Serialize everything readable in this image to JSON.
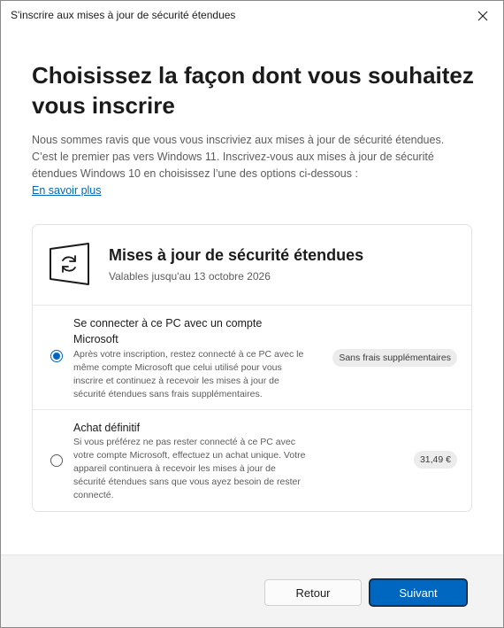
{
  "window": {
    "title": "S'inscrire aux mises à jour de sécurité étendues"
  },
  "heading": "Choisissez la façon dont vous souhaitez vous inscrire",
  "intro": "Nous sommes ravis que vous vous inscriviez aux mises à jour de sécurité étendues. C’est le premier pas vers Windows 11. Inscrivez-vous aux mises à jour de sécurité étendues Windows 10 en choisissez l’une des options ci-dessous :",
  "learn_more": "En savoir plus",
  "card": {
    "icon": "windows-refresh-icon",
    "title": "Mises à jour de sécurité étendues",
    "subtitle": "Valables jusqu'au 13 octobre 2026"
  },
  "options": [
    {
      "title": "Se connecter à ce PC avec un compte Microsoft",
      "description": "Après votre inscription, restez connecté à ce PC avec le même compte Microsoft que celui utilisé pour vous inscrire et continuez à recevoir les mises à jour de sécurité étendues sans frais supplémentaires.",
      "badge": "Sans frais supplémentaires",
      "selected": true
    },
    {
      "title": "Achat définitif",
      "description": "Si vous préférez ne pas rester connecté à ce PC avec votre compte Microsoft, effectuez un achat unique. Votre appareil continuera à recevoir les mises à jour de sécurité étendues sans que vous ayez besoin de rester connecté.",
      "badge": "31,49 €",
      "selected": false
    }
  ],
  "buttons": {
    "back": "Retour",
    "next": "Suivant"
  },
  "colors": {
    "accent": "#0067c0",
    "link": "#0067c0"
  }
}
